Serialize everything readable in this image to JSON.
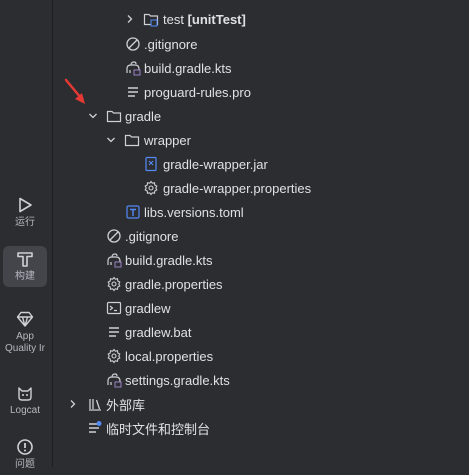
{
  "sidebar": {
    "items": [
      {
        "label": "运行",
        "icon": "run-icon"
      },
      {
        "label": "构建",
        "icon": "build-hammer-icon"
      },
      {
        "label": "App Quality Ir",
        "icon": "app-quality-icon"
      },
      {
        "label": "Logcat",
        "icon": "logcat-icon"
      },
      {
        "label": "问题",
        "icon": "problems-icon"
      }
    ]
  },
  "tree": {
    "test_label": "test",
    "test_suffix": "[unitTest]",
    "app_gitignore": ".gitignore",
    "app_build_gradle": "build.gradle.kts",
    "proguard": "proguard-rules.pro",
    "gradle_folder": "gradle",
    "wrapper_folder": "wrapper",
    "wrapper_jar": "gradle-wrapper.jar",
    "wrapper_props": "gradle-wrapper.properties",
    "libs_versions": "libs.versions.toml",
    "root_gitignore": ".gitignore",
    "root_build_gradle": "build.gradle.kts",
    "gradle_props": "gradle.properties",
    "gradlew": "gradlew",
    "gradlew_bat": "gradlew.bat",
    "local_props": "local.properties",
    "settings_gradle": "settings.gradle.kts",
    "external_libs": "外部库",
    "scratches": "临时文件和控制台"
  },
  "colors": {
    "background": "#2b2d30",
    "text": "#dfe1e5",
    "icon": "#ced0d6",
    "accent_blue": "#548af7",
    "annotation_red": "#e53935"
  }
}
